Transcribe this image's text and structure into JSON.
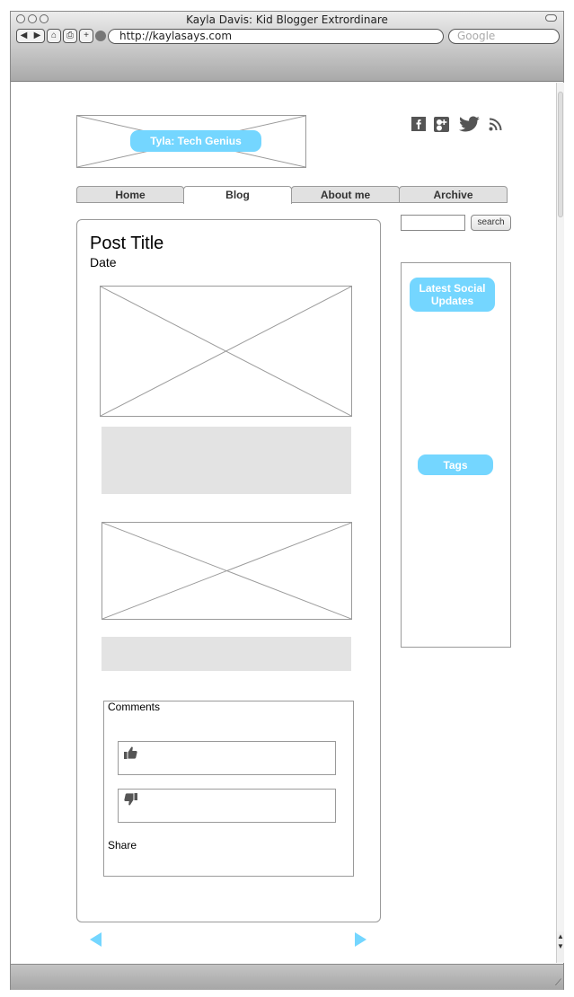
{
  "browser": {
    "title": "Kayla Davis: Kid Blogger Extrordinare",
    "url": "http://kaylasays.com",
    "search_placeholder": "Google",
    "back_label": "◀",
    "forward_label": "▶",
    "home_label": "⌂",
    "print_label": "⎙",
    "add_label": "+"
  },
  "header": {
    "logo_label": "Tyla: Tech Genius",
    "social_icons": [
      "facebook-icon",
      "google-plus-icon",
      "twitter-icon",
      "rss-icon"
    ]
  },
  "nav": {
    "tabs": [
      {
        "label": "Home",
        "active": false
      },
      {
        "label": "Blog",
        "active": true
      },
      {
        "label": "About me",
        "active": false
      },
      {
        "label": "Archive",
        "active": false
      }
    ]
  },
  "search": {
    "button_label": "search",
    "value": ""
  },
  "post": {
    "title": "Post Title",
    "date": "Date",
    "comments_label": "Comments",
    "share_label": "Share",
    "vote_icons": [
      "thumbs-up-icon",
      "thumbs-down-icon"
    ]
  },
  "sidebar": {
    "latest_social_label": "Latest Social Updates",
    "tags_label": "Tags"
  },
  "colors": {
    "accent": "#74d6ff",
    "placeholder_gray": "#e3e3e3",
    "border": "#9a9a9a"
  }
}
